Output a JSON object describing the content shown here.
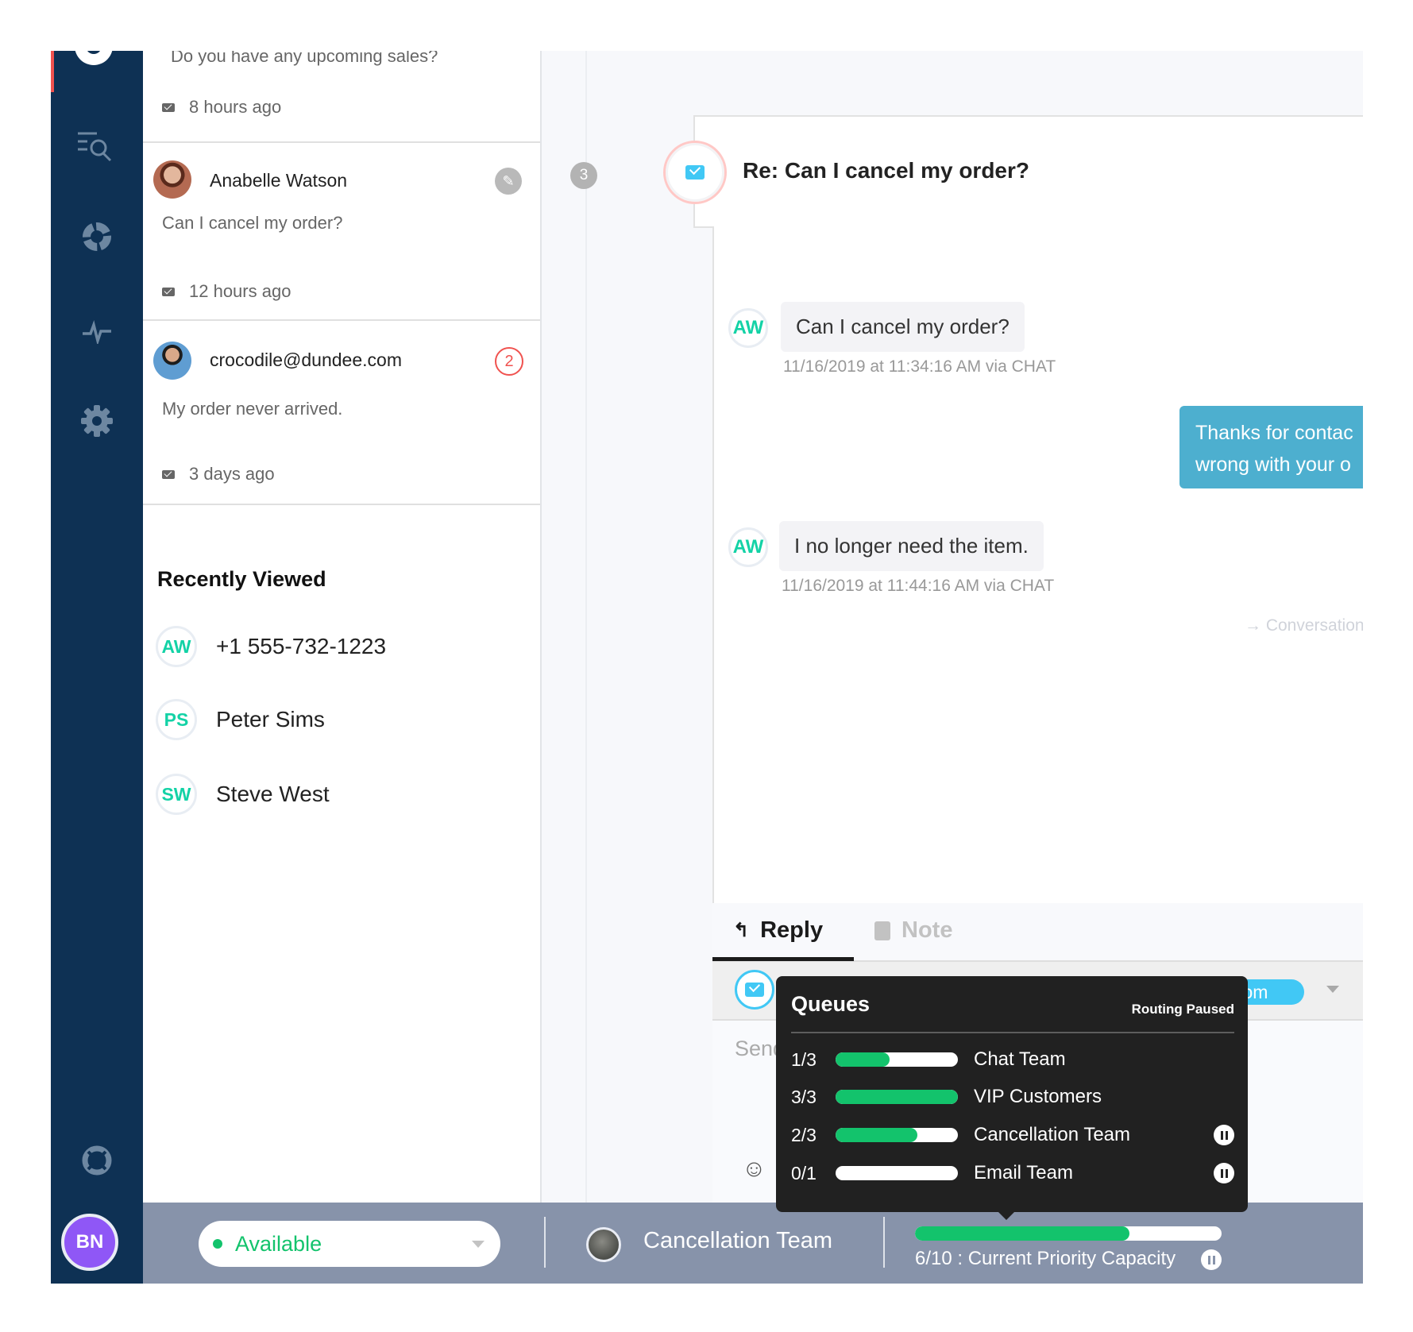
{
  "sidebar": {
    "items": [
      {
        "name": "search-list-icon"
      },
      {
        "name": "reports-donut-icon"
      },
      {
        "name": "activity-pulse-icon"
      },
      {
        "name": "settings-gear-icon"
      },
      {
        "name": "help-lifebuoy-icon"
      }
    ],
    "user_initials": "BN"
  },
  "conversations": [
    {
      "preview": "Do you have any upcoming sales?",
      "time": "8 hours ago"
    },
    {
      "name": "Anabelle Watson",
      "preview": "Can I cancel my order?",
      "time": "12 hours ago"
    },
    {
      "name": "crocodile@dundee.com",
      "preview": "My order never arrived.",
      "time": "3 days ago",
      "unread_count": "2"
    }
  ],
  "recently_viewed": {
    "title": "Recently Viewed",
    "items": [
      {
        "initials": "AW",
        "label": "+1 555-732-1223"
      },
      {
        "initials": "PS",
        "label": "Peter Sims"
      },
      {
        "initials": "SW",
        "label": "Steve West"
      }
    ]
  },
  "thread": {
    "step": "3",
    "subject": "Re: Can I cancel my order?",
    "messages": [
      {
        "initials": "AW",
        "text": "Can I cancel my order?",
        "meta": "11/16/2019 at 11:34:16 AM via CHAT"
      },
      {
        "agent": true,
        "text_line1": "Thanks for contac",
        "text_line2": "wrong with your o"
      },
      {
        "initials": "AW",
        "text": "I no longer need the item.",
        "meta": "11/16/2019 at 11:44:16 AM via CHAT"
      }
    ],
    "conversation_link": "→ Conversation"
  },
  "composer": {
    "tabs": [
      {
        "label": "Reply",
        "active": true
      },
      {
        "label": "Note",
        "active": false
      }
    ],
    "to_chip": "com",
    "placeholder": "Send"
  },
  "queues": {
    "title": "Queues",
    "status": "Routing Paused",
    "rows": [
      {
        "count": "1/3",
        "fill": 0.44,
        "name": "Chat Team",
        "paused": false
      },
      {
        "count": "3/3",
        "fill": 1.0,
        "name": "VIP Customers",
        "paused": false
      },
      {
        "count": "2/3",
        "fill": 0.67,
        "name": "Cancellation Team",
        "paused": true
      },
      {
        "count": "0/1",
        "fill": 0.0,
        "name": "Email Team",
        "paused": true
      }
    ]
  },
  "footer": {
    "status": "Available",
    "team": "Cancellation Team",
    "capacity_label": "6/10 : Current Priority Capacity",
    "capacity_fill": 0.7
  },
  "colors": {
    "accent_green": "#13c36c",
    "sidebar": "#0e3154",
    "alert": "#f0524f",
    "chat_blue": "#41c8f5"
  }
}
